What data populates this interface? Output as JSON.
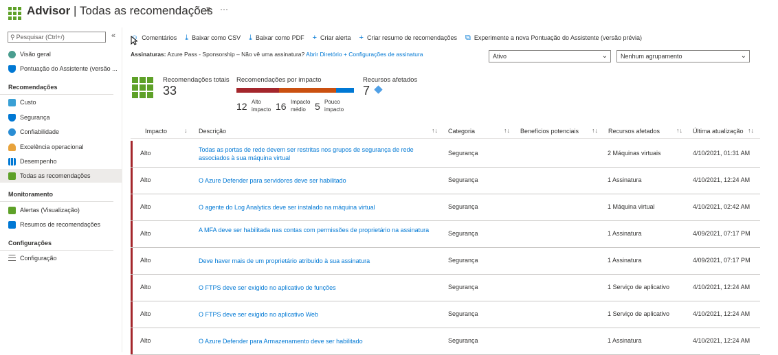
{
  "header": {
    "app": "Advisor",
    "separator": "|",
    "title": "Todas as recomendações",
    "pin_icon": "pin-icon",
    "more": "···"
  },
  "sidebar": {
    "search_placeholder": "Pesquisar (Ctrl+/)",
    "collapse": "«",
    "top_items": [
      {
        "label": "Visão geral",
        "icon": "overview-icon",
        "color": "#4a9d8f"
      },
      {
        "label": "Pontuação do Assistente (versão ...",
        "icon": "shield-icon",
        "color": "#0078d4"
      }
    ],
    "section_recs": "Recomendações",
    "recs_items": [
      {
        "label": "Custo",
        "icon": "cost-icon",
        "color": "#3aa0d5"
      },
      {
        "label": "Segurança",
        "icon": "security-icon",
        "color": "#0078d4"
      },
      {
        "label": "Confiabilidade",
        "icon": "reliability-icon",
        "color": "#2a8dd4"
      },
      {
        "label": "Excelência operacional",
        "icon": "operations-icon",
        "color": "#e8a33c"
      },
      {
        "label": "Desempenho",
        "icon": "performance-icon",
        "color": "#0078d4"
      },
      {
        "label": "Todas as recomendações",
        "icon": "grid-icon",
        "color": "#5ea128"
      }
    ],
    "section_monitor": "Monitoramento",
    "monitor_items": [
      {
        "label": "Alertas (Visualização)",
        "icon": "alert-icon",
        "color": "#5ea128"
      },
      {
        "label": "Resumos de recomendações",
        "icon": "digest-icon",
        "color": "#0078d4"
      }
    ],
    "section_config": "Configurações",
    "config_items": [
      {
        "label": "Configuração",
        "icon": "settings-icon",
        "color": "#605e5c"
      }
    ]
  },
  "toolbar": {
    "feedback": "Comentários",
    "csv": "Baixar como CSV",
    "pdf": "Baixar como PDF",
    "alert": "Criar alerta",
    "digest": "Criar resumo de recomendações",
    "try_new": "Experimente a nova Pontuação do Assistente (versão prévia)"
  },
  "subscriptions": {
    "label": "Assinaturas:",
    "value": "Azure Pass - Sponsorship – Não vê uma assinatura?",
    "link": "Abrir Diretório + Configurações de assinatura"
  },
  "filters": {
    "status": "Ativo",
    "grouping": "Nenhum agrupamento"
  },
  "summary": {
    "total_label": "Recomendações totais",
    "total": "33",
    "impact_label": "Recomendações por impacto",
    "high_count": "12",
    "high_label_1": "Alto",
    "high_label_2": "impacto",
    "med_count": "16",
    "med_label_1": "Impacto",
    "med_label_2": "médio",
    "low_count": "5",
    "low_label_1": "Pouco",
    "low_label_2": "impacto",
    "affected_label": "Recursos afetados",
    "affected": "7",
    "colors": {
      "high": "#a4262c",
      "medium": "#ca5010",
      "low": "#0078d4"
    }
  },
  "table": {
    "headers": {
      "impact": "Impacto",
      "description": "Descrição",
      "category": "Categoria",
      "benefits": "Benefícios potenciais",
      "resources": "Recursos afetados",
      "updated": "Última atualização"
    },
    "rows": [
      {
        "impact": "Alto",
        "description": "Todas as portas de rede devem ser restritas nos grupos de segurança de rede associados à sua máquina virtual",
        "category": "Segurança",
        "resources": "2 Máquinas virtuais",
        "updated": "4/10/2021, 01:31 AM"
      },
      {
        "impact": "Alto",
        "description": "O Azure Defender para servidores deve ser habilitado",
        "category": "Segurança",
        "resources": "1 Assinatura",
        "updated": "4/10/2021, 12:24 AM"
      },
      {
        "impact": "Alto",
        "description": "O agente do Log Analytics deve ser instalado na máquina virtual",
        "category": "Segurança",
        "resources": "1 Máquina virtual",
        "updated": "4/10/2021, 02:42 AM"
      },
      {
        "impact": "Alto",
        "description": "A MFA deve ser habilitada nas contas com permissões de proprietário na assinatura",
        "category": "Segurança",
        "resources": "1 Assinatura",
        "updated": "4/09/2021, 07:17 PM"
      },
      {
        "impact": "Alto",
        "description": "Deve haver mais de um proprietário atribuído à sua assinatura",
        "category": "Segurança",
        "resources": "1 Assinatura",
        "updated": "4/09/2021, 07:17 PM"
      },
      {
        "impact": "Alto",
        "description": "O FTPS deve ser exigido no aplicativo de funções",
        "category": "Segurança",
        "resources": "1 Serviço de aplicativo",
        "updated": "4/10/2021, 12:24 AM"
      },
      {
        "impact": "Alto",
        "description": "O FTPS deve ser exigido no aplicativo Web",
        "category": "Segurança",
        "resources": "1 Serviço de aplicativo",
        "updated": "4/10/2021, 12:24 AM"
      },
      {
        "impact": "Alto",
        "description": "O Azure Defender para Armazenamento deve ser habilitado",
        "category": "Segurança",
        "resources": "1 Assinatura",
        "updated": "4/10/2021, 12:24 AM"
      }
    ]
  }
}
